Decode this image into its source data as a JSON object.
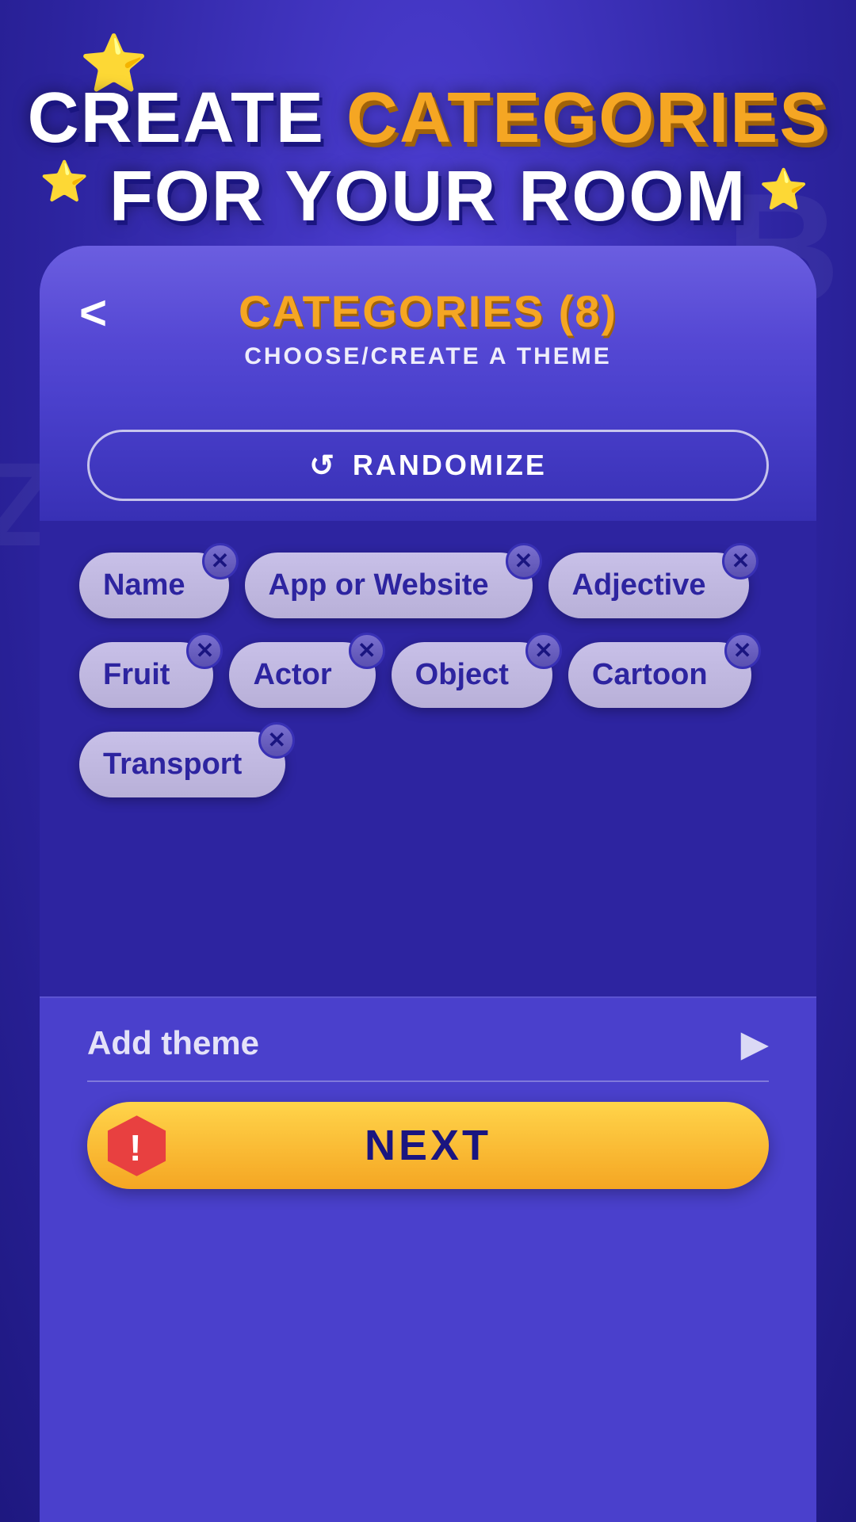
{
  "background": {
    "stars": [
      "⭐",
      "⭐",
      "⭐"
    ],
    "bgLetters": [
      "B",
      "Z"
    ]
  },
  "mainTitle": {
    "line1_part1": "CREATE ",
    "line1_part2": "CATEGORIES",
    "line2": "FOR YOUR ROOM"
  },
  "card": {
    "backLabel": "<",
    "title": "CATEGORIES (8)",
    "subtitle": "CHOOSE/CREATE A THEME",
    "randomizeLabel": "RANDOMIZE",
    "tags": [
      {
        "id": "name",
        "label": "Name"
      },
      {
        "id": "app-or-website",
        "label": "App or Website"
      },
      {
        "id": "adjective",
        "label": "Adjective"
      },
      {
        "id": "fruit",
        "label": "Fruit"
      },
      {
        "id": "actor",
        "label": "Actor"
      },
      {
        "id": "object",
        "label": "Object"
      },
      {
        "id": "cartoon",
        "label": "Cartoon"
      },
      {
        "id": "transport",
        "label": "Transport"
      }
    ],
    "addThemeLabel": "Add theme",
    "addThemeArrow": "▶",
    "nextLabel": "NEXT"
  }
}
